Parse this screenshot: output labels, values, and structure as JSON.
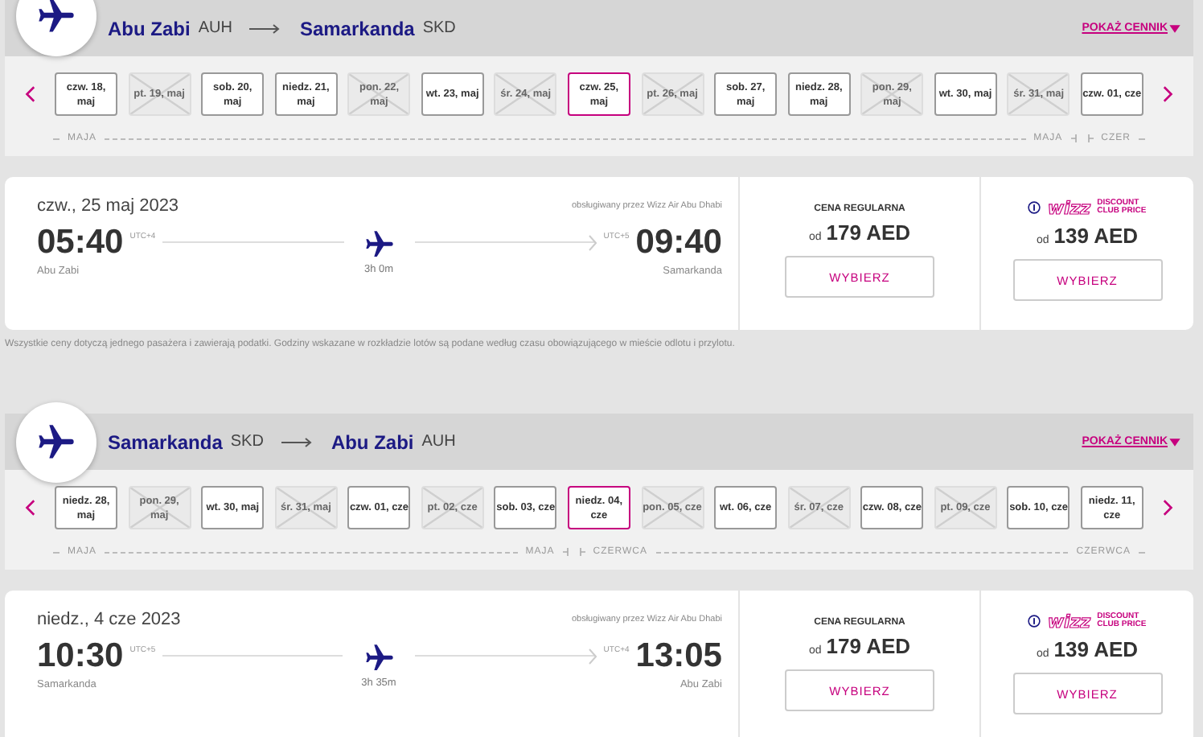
{
  "legs": [
    {
      "from": {
        "city": "Abu Zabi",
        "code": "AUH"
      },
      "to": {
        "city": "Samarkanda",
        "code": "SKD"
      },
      "show_prices": "POKAŻ CENNIK",
      "dates": [
        {
          "label": "czw. 18, maj",
          "available": true,
          "selected": false
        },
        {
          "label": "pt. 19, maj",
          "available": false,
          "selected": false
        },
        {
          "label": "sob. 20, maj",
          "available": true,
          "selected": false
        },
        {
          "label": "niedz. 21, maj",
          "available": true,
          "selected": false
        },
        {
          "label": "pon. 22, maj",
          "available": false,
          "selected": false
        },
        {
          "label": "wt. 23, maj",
          "available": true,
          "selected": false
        },
        {
          "label": "śr. 24, maj",
          "available": false,
          "selected": false
        },
        {
          "label": "czw. 25, maj",
          "available": true,
          "selected": true
        },
        {
          "label": "pt. 26, maj",
          "available": false,
          "selected": false
        },
        {
          "label": "sob. 27, maj",
          "available": true,
          "selected": false
        },
        {
          "label": "niedz. 28, maj",
          "available": true,
          "selected": false
        },
        {
          "label": "pon. 29, maj",
          "available": false,
          "selected": false
        },
        {
          "label": "wt. 30, maj",
          "available": true,
          "selected": false
        },
        {
          "label": "śr. 31, maj",
          "available": false,
          "selected": false
        },
        {
          "label": "czw. 01, cze",
          "available": true,
          "selected": false
        }
      ],
      "timeline": [
        {
          "label": "MAJA",
          "break_before": false
        },
        {
          "label": "MAJA",
          "break_before": false
        },
        {
          "label": "CZER",
          "break_before": true
        }
      ],
      "flight": {
        "date": "czw., 25 maj 2023",
        "operator": "obsługiwany przez Wizz Air Abu Dhabi",
        "dep_time": "05:40",
        "dep_tz": "UTC+4",
        "arr_time": "09:40",
        "arr_tz": "UTC+5",
        "dep_city": "Abu Zabi",
        "arr_city": "Samarkanda",
        "duration": "3h 0m",
        "regular": {
          "title": "CENA REGULARNA",
          "from": "od",
          "price": "179 AED",
          "button": "WYBIERZ"
        },
        "club": {
          "logo": "wizz",
          "line1": "DISCOUNT",
          "line2": "CLUB PRICE",
          "from": "od",
          "price": "139 AED",
          "button": "WYBIERZ"
        }
      },
      "note": "Wszystkie ceny dotyczą jednego pasażera i zawierają podatki. Godziny wskazane w rozkładzie lotów są podane według czasu obowiązującego w mieście odlotu i przylotu."
    },
    {
      "from": {
        "city": "Samarkanda",
        "code": "SKD"
      },
      "to": {
        "city": "Abu Zabi",
        "code": "AUH"
      },
      "show_prices": "POKAŻ CENNIK",
      "dates": [
        {
          "label": "niedz. 28, maj",
          "available": true,
          "selected": false
        },
        {
          "label": "pon. 29, maj",
          "available": false,
          "selected": false
        },
        {
          "label": "wt. 30, maj",
          "available": true,
          "selected": false
        },
        {
          "label": "śr. 31, maj",
          "available": false,
          "selected": false
        },
        {
          "label": "czw. 01, cze",
          "available": true,
          "selected": false
        },
        {
          "label": "pt. 02, cze",
          "available": false,
          "selected": false
        },
        {
          "label": "sob. 03, cze",
          "available": true,
          "selected": false
        },
        {
          "label": "niedz. 04, cze",
          "available": true,
          "selected": true
        },
        {
          "label": "pon. 05, cze",
          "available": false,
          "selected": false
        },
        {
          "label": "wt. 06, cze",
          "available": true,
          "selected": false
        },
        {
          "label": "śr. 07, cze",
          "available": false,
          "selected": false
        },
        {
          "label": "czw. 08, cze",
          "available": true,
          "selected": false
        },
        {
          "label": "pt. 09, cze",
          "available": false,
          "selected": false
        },
        {
          "label": "sob. 10, cze",
          "available": true,
          "selected": false
        },
        {
          "label": "niedz. 11, cze",
          "available": true,
          "selected": false
        }
      ],
      "timeline": [
        {
          "label": "MAJA",
          "break_before": false
        },
        {
          "label": "MAJA",
          "break_before": false
        },
        {
          "label": "CZERWCA",
          "break_before": true
        },
        {
          "label": "CZERWCA",
          "break_before": false
        }
      ],
      "flight": {
        "date": "niedz., 4 cze 2023",
        "operator": "obsługiwany przez Wizz Air Abu Dhabi",
        "dep_time": "10:30",
        "dep_tz": "UTC+5",
        "arr_time": "13:05",
        "arr_tz": "UTC+4",
        "dep_city": "Samarkanda",
        "arr_city": "Abu Zabi",
        "duration": "3h 35m",
        "regular": {
          "title": "CENA REGULARNA",
          "from": "od",
          "price": "179 AED",
          "button": "WYBIERZ"
        },
        "club": {
          "logo": "wizz",
          "line1": "DISCOUNT",
          "line2": "CLUB PRICE",
          "from": "od",
          "price": "139 AED",
          "button": "WYBIERZ"
        }
      }
    }
  ]
}
